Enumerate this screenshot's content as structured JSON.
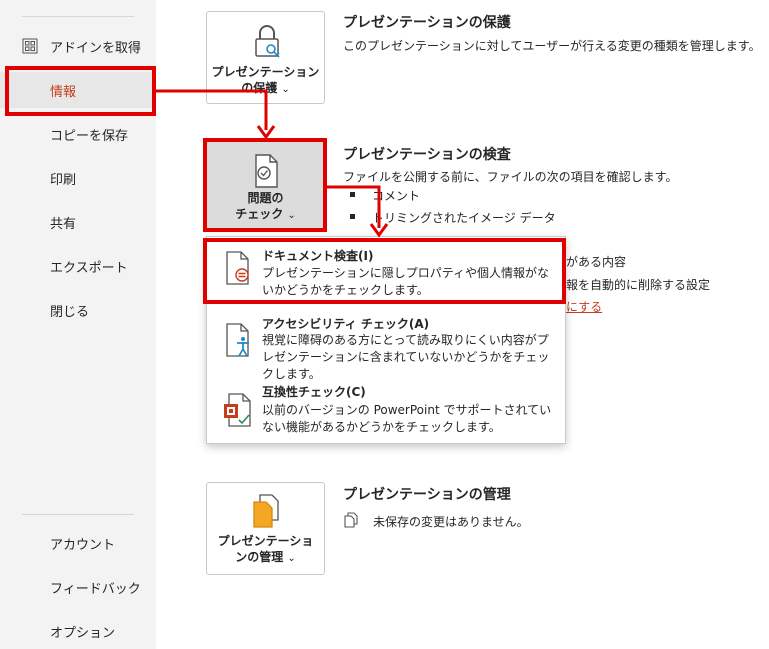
{
  "sidebar": {
    "items": [
      {
        "label": "アドインを取得",
        "icon": "addins-grid-icon"
      },
      {
        "label": "情報"
      },
      {
        "label": "コピーを保存"
      },
      {
        "label": "印刷"
      },
      {
        "label": "共有"
      },
      {
        "label": "エクスポート"
      },
      {
        "label": "閉じる"
      }
    ],
    "bottom_items": [
      {
        "label": "アカウント"
      },
      {
        "label": "フィードバック"
      },
      {
        "label": "オプション"
      }
    ]
  },
  "protect": {
    "button_line1": "プレゼンテーション",
    "button_line2": "の保護",
    "title": "プレゼンテーションの保護",
    "desc": "このプレゼンテーションに対してユーザーが行える変更の種類を管理します。",
    "icon": "lock-key-icon"
  },
  "inspect": {
    "button_line1": "問題の",
    "button_line2": "チェック",
    "title": "プレゼンテーションの検査",
    "desc": "ファイルを公開する前に、ファイルの次の項目を確認します。",
    "bullets": [
      "コメント",
      "トリミングされたイメージ データ"
    ],
    "partial_right_1": "がある内容",
    "partial_right_2": "報を自動的に削除する設定",
    "partial_link": "にする",
    "icon": "document-check-icon"
  },
  "menu": {
    "items": [
      {
        "title": "ドキュメント検査(I)",
        "desc": "プレゼンテーションに隠しプロパティや個人情報がないかどうかをチェックします。",
        "icon": "document-inspect-icon"
      },
      {
        "title": "アクセシビリティ チェック(A)",
        "desc": "視覚に障碍のある方にとって読み取りにくい内容がプレゼンテーションに含まれていないかどうかをチェックします。",
        "icon": "accessibility-icon"
      },
      {
        "title": "互換性チェック(C)",
        "desc": "以前のバージョンの PowerPoint でサポートされていない機能があるかどうかをチェックします。",
        "icon": "compatibility-icon"
      }
    ]
  },
  "manage": {
    "button_line1": "プレゼンテーショ",
    "button_line2": "ンの管理",
    "title": "プレゼンテーションの管理",
    "status": "未保存の変更はありません。",
    "icon": "document-copy-icon"
  },
  "colors": {
    "accent": "#c43e1c",
    "annotation": "#e00000"
  }
}
